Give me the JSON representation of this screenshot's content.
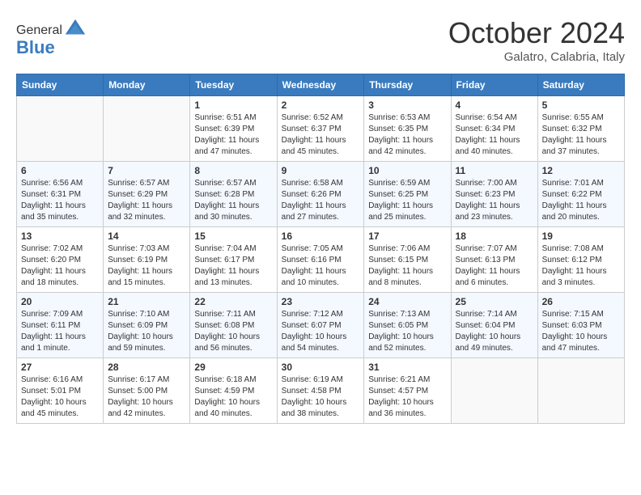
{
  "header": {
    "logo_general": "General",
    "logo_blue": "Blue",
    "month": "October 2024",
    "location": "Galatro, Calabria, Italy"
  },
  "weekdays": [
    "Sunday",
    "Monday",
    "Tuesday",
    "Wednesday",
    "Thursday",
    "Friday",
    "Saturday"
  ],
  "weeks": [
    [
      {
        "day": "",
        "info": ""
      },
      {
        "day": "",
        "info": ""
      },
      {
        "day": "1",
        "info": "Sunrise: 6:51 AM\nSunset: 6:39 PM\nDaylight: 11 hours and 47 minutes."
      },
      {
        "day": "2",
        "info": "Sunrise: 6:52 AM\nSunset: 6:37 PM\nDaylight: 11 hours and 45 minutes."
      },
      {
        "day": "3",
        "info": "Sunrise: 6:53 AM\nSunset: 6:35 PM\nDaylight: 11 hours and 42 minutes."
      },
      {
        "day": "4",
        "info": "Sunrise: 6:54 AM\nSunset: 6:34 PM\nDaylight: 11 hours and 40 minutes."
      },
      {
        "day": "5",
        "info": "Sunrise: 6:55 AM\nSunset: 6:32 PM\nDaylight: 11 hours and 37 minutes."
      }
    ],
    [
      {
        "day": "6",
        "info": "Sunrise: 6:56 AM\nSunset: 6:31 PM\nDaylight: 11 hours and 35 minutes."
      },
      {
        "day": "7",
        "info": "Sunrise: 6:57 AM\nSunset: 6:29 PM\nDaylight: 11 hours and 32 minutes."
      },
      {
        "day": "8",
        "info": "Sunrise: 6:57 AM\nSunset: 6:28 PM\nDaylight: 11 hours and 30 minutes."
      },
      {
        "day": "9",
        "info": "Sunrise: 6:58 AM\nSunset: 6:26 PM\nDaylight: 11 hours and 27 minutes."
      },
      {
        "day": "10",
        "info": "Sunrise: 6:59 AM\nSunset: 6:25 PM\nDaylight: 11 hours and 25 minutes."
      },
      {
        "day": "11",
        "info": "Sunrise: 7:00 AM\nSunset: 6:23 PM\nDaylight: 11 hours and 23 minutes."
      },
      {
        "day": "12",
        "info": "Sunrise: 7:01 AM\nSunset: 6:22 PM\nDaylight: 11 hours and 20 minutes."
      }
    ],
    [
      {
        "day": "13",
        "info": "Sunrise: 7:02 AM\nSunset: 6:20 PM\nDaylight: 11 hours and 18 minutes."
      },
      {
        "day": "14",
        "info": "Sunrise: 7:03 AM\nSunset: 6:19 PM\nDaylight: 11 hours and 15 minutes."
      },
      {
        "day": "15",
        "info": "Sunrise: 7:04 AM\nSunset: 6:17 PM\nDaylight: 11 hours and 13 minutes."
      },
      {
        "day": "16",
        "info": "Sunrise: 7:05 AM\nSunset: 6:16 PM\nDaylight: 11 hours and 10 minutes."
      },
      {
        "day": "17",
        "info": "Sunrise: 7:06 AM\nSunset: 6:15 PM\nDaylight: 11 hours and 8 minutes."
      },
      {
        "day": "18",
        "info": "Sunrise: 7:07 AM\nSunset: 6:13 PM\nDaylight: 11 hours and 6 minutes."
      },
      {
        "day": "19",
        "info": "Sunrise: 7:08 AM\nSunset: 6:12 PM\nDaylight: 11 hours and 3 minutes."
      }
    ],
    [
      {
        "day": "20",
        "info": "Sunrise: 7:09 AM\nSunset: 6:11 PM\nDaylight: 11 hours and 1 minute."
      },
      {
        "day": "21",
        "info": "Sunrise: 7:10 AM\nSunset: 6:09 PM\nDaylight: 10 hours and 59 minutes."
      },
      {
        "day": "22",
        "info": "Sunrise: 7:11 AM\nSunset: 6:08 PM\nDaylight: 10 hours and 56 minutes."
      },
      {
        "day": "23",
        "info": "Sunrise: 7:12 AM\nSunset: 6:07 PM\nDaylight: 10 hours and 54 minutes."
      },
      {
        "day": "24",
        "info": "Sunrise: 7:13 AM\nSunset: 6:05 PM\nDaylight: 10 hours and 52 minutes."
      },
      {
        "day": "25",
        "info": "Sunrise: 7:14 AM\nSunset: 6:04 PM\nDaylight: 10 hours and 49 minutes."
      },
      {
        "day": "26",
        "info": "Sunrise: 7:15 AM\nSunset: 6:03 PM\nDaylight: 10 hours and 47 minutes."
      }
    ],
    [
      {
        "day": "27",
        "info": "Sunrise: 6:16 AM\nSunset: 5:01 PM\nDaylight: 10 hours and 45 minutes."
      },
      {
        "day": "28",
        "info": "Sunrise: 6:17 AM\nSunset: 5:00 PM\nDaylight: 10 hours and 42 minutes."
      },
      {
        "day": "29",
        "info": "Sunrise: 6:18 AM\nSunset: 4:59 PM\nDaylight: 10 hours and 40 minutes."
      },
      {
        "day": "30",
        "info": "Sunrise: 6:19 AM\nSunset: 4:58 PM\nDaylight: 10 hours and 38 minutes."
      },
      {
        "day": "31",
        "info": "Sunrise: 6:21 AM\nSunset: 4:57 PM\nDaylight: 10 hours and 36 minutes."
      },
      {
        "day": "",
        "info": ""
      },
      {
        "day": "",
        "info": ""
      }
    ]
  ]
}
